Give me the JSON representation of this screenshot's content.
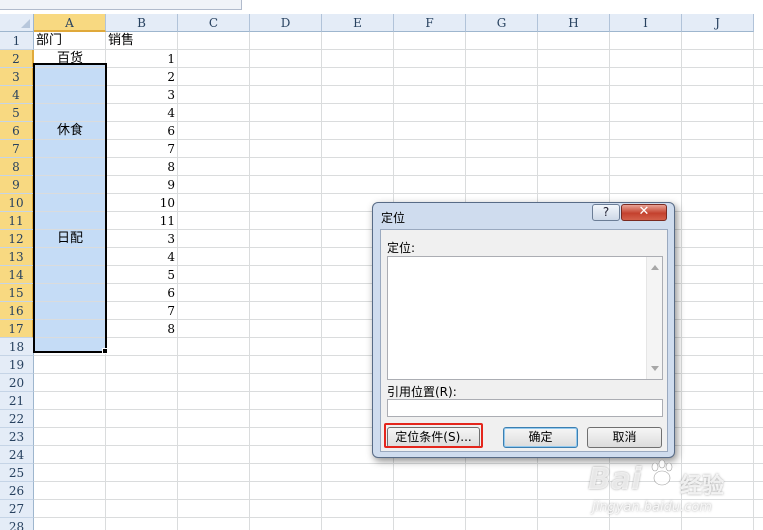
{
  "columns": [
    "A",
    "B",
    "C",
    "D",
    "E",
    "F",
    "G",
    "H",
    "I",
    "J"
  ],
  "rows": [
    "1",
    "2",
    "3",
    "4",
    "5",
    "6",
    "7",
    "8",
    "9",
    "10",
    "11",
    "12",
    "13",
    "14",
    "15",
    "16",
    "17",
    "18",
    "19",
    "20",
    "21",
    "22",
    "23",
    "24",
    "25",
    "26",
    "27",
    "28"
  ],
  "cells": {
    "A1": "部门",
    "B1": "销售",
    "A2": "百货",
    "A6": "休食",
    "A12": "日配",
    "B2": "1",
    "B3": "2",
    "B4": "3",
    "B5": "4",
    "B6": "6",
    "B7": "7",
    "B8": "8",
    "B9": "9",
    "B10": "10",
    "B11": "11",
    "B12": "3",
    "B13": "4",
    "B14": "5",
    "B15": "6",
    "B16": "7",
    "B17": "8"
  },
  "selection": {
    "range": "A2:A17",
    "fill_color": "#c5dcf6",
    "header_highlight": "#f8d981"
  },
  "dialog": {
    "title": "定位",
    "help_icon": "?",
    "close_icon": "✕",
    "goto_label": "定位:",
    "reference_label": "引用位置(R):",
    "reference_value": "",
    "special_button": "定位条件(S)...",
    "ok_button": "确定",
    "cancel_button": "取消"
  },
  "watermark": {
    "brand": "Bai",
    "suffix": "经验",
    "url": "jingyan.baidu.com"
  },
  "colors": {
    "highlight_box": "#e4261c",
    "close_button": "#c4412e"
  }
}
